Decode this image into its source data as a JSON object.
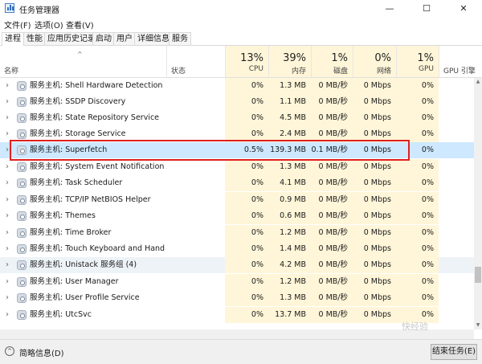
{
  "window": {
    "title": "任务管理器"
  },
  "menu": [
    "文件(F)",
    "选项(O)",
    "查看(V)"
  ],
  "tabs": [
    "进程",
    "性能",
    "应用历史记录",
    "启动",
    "用户",
    "详细信息",
    "服务"
  ],
  "columns": {
    "name": "名称",
    "status": "状态",
    "cpu": {
      "pct": "13%",
      "label": "CPU"
    },
    "mem": {
      "pct": "39%",
      "label": "内存"
    },
    "disk": {
      "pct": "1%",
      "label": "磁盘"
    },
    "net": {
      "pct": "0%",
      "label": "网络"
    },
    "gpu": {
      "pct": "1%",
      "label": "GPU"
    },
    "gpu_engine": "GPU 引擎"
  },
  "rows": [
    {
      "name": "服务主机: Shell Hardware Detection",
      "cpu": "0%",
      "mem": "1.3 MB",
      "disk": "0 MB/秒",
      "net": "0 Mbps",
      "gpu": "0%"
    },
    {
      "name": "服务主机: SSDP Discovery",
      "cpu": "0%",
      "mem": "1.1 MB",
      "disk": "0 MB/秒",
      "net": "0 Mbps",
      "gpu": "0%"
    },
    {
      "name": "服务主机: State Repository Service",
      "cpu": "0%",
      "mem": "4.5 MB",
      "disk": "0 MB/秒",
      "net": "0 Mbps",
      "gpu": "0%"
    },
    {
      "name": "服务主机: Storage Service",
      "cpu": "0%",
      "mem": "2.4 MB",
      "disk": "0 MB/秒",
      "net": "0 Mbps",
      "gpu": "0%"
    },
    {
      "name": "服务主机: Superfetch",
      "cpu": "0.5%",
      "mem": "139.3 MB",
      "disk": "0.1 MB/秒",
      "net": "0 Mbps",
      "gpu": "0%"
    },
    {
      "name": "服务主机: System Event Notification S...",
      "cpu": "0%",
      "mem": "1.3 MB",
      "disk": "0 MB/秒",
      "net": "0 Mbps",
      "gpu": "0%"
    },
    {
      "name": "服务主机: Task Scheduler",
      "cpu": "0%",
      "mem": "4.1 MB",
      "disk": "0 MB/秒",
      "net": "0 Mbps",
      "gpu": "0%"
    },
    {
      "name": "服务主机: TCP/IP NetBIOS Helper",
      "cpu": "0%",
      "mem": "0.9 MB",
      "disk": "0 MB/秒",
      "net": "0 Mbps",
      "gpu": "0%"
    },
    {
      "name": "服务主机: Themes",
      "cpu": "0%",
      "mem": "0.6 MB",
      "disk": "0 MB/秒",
      "net": "0 Mbps",
      "gpu": "0%"
    },
    {
      "name": "服务主机: Time Broker",
      "cpu": "0%",
      "mem": "1.2 MB",
      "disk": "0 MB/秒",
      "net": "0 Mbps",
      "gpu": "0%"
    },
    {
      "name": "服务主机: Touch Keyboard and Hand...",
      "cpu": "0%",
      "mem": "1.4 MB",
      "disk": "0 MB/秒",
      "net": "0 Mbps",
      "gpu": "0%"
    },
    {
      "name": "服务主机: Unistack 服务组 (4)",
      "cpu": "0%",
      "mem": "4.2 MB",
      "disk": "0 MB/秒",
      "net": "0 Mbps",
      "gpu": "0%"
    },
    {
      "name": "服务主机: User Manager",
      "cpu": "0%",
      "mem": "1.2 MB",
      "disk": "0 MB/秒",
      "net": "0 Mbps",
      "gpu": "0%"
    },
    {
      "name": "服务主机: User Profile Service",
      "cpu": "0%",
      "mem": "1.3 MB",
      "disk": "0 MB/秒",
      "net": "0 Mbps",
      "gpu": "0%"
    },
    {
      "name": "服务主机: UtcSvc",
      "cpu": "0%",
      "mem": "13.7 MB",
      "disk": "0 MB/秒",
      "net": "0 Mbps",
      "gpu": "0%"
    }
  ],
  "footer": {
    "fewer_details": "简略信息(D)",
    "end_task": "结束任务(E)"
  },
  "watermark": "快经验",
  "colors": {
    "selection": "#cde8ff",
    "highlight_box": "#e02020",
    "heat": "#fff6d9"
  }
}
